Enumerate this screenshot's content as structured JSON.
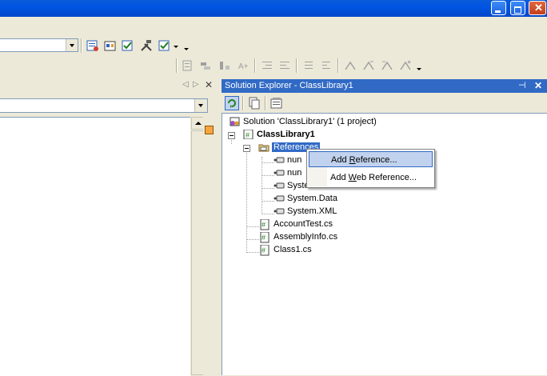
{
  "window": {
    "buttons": [
      "minimize",
      "maximize",
      "close"
    ]
  },
  "toolbar": {
    "icons_row1": [
      "properties-icon",
      "object-browser-icon",
      "toolbox-icon",
      "tools-icon",
      "command-window-icon"
    ],
    "icons_row2": [
      "align-icon",
      "size-icon",
      "spacing-icon",
      "text-size-icon",
      "indent-icon",
      "outdent-icon",
      "comment-icon",
      "uncomment-icon",
      "bookmark-icon"
    ]
  },
  "solution_explorer": {
    "title": "Solution Explorer - ClassLibrary1",
    "pin": "⊣",
    "close": "✕",
    "tree": {
      "solution": "Solution 'ClassLibrary1' (1 project)",
      "project": "ClassLibrary1",
      "references": "References",
      "ref_items": [
        "nun",
        "nun",
        "System",
        "System.Data",
        "System.XML"
      ],
      "files": [
        "AccountTest.cs",
        "AssemblyInfo.cs",
        "Class1.cs"
      ]
    }
  },
  "context_menu": {
    "items": [
      {
        "label_pre": "Add ",
        "label_ul": "R",
        "label_post": "eference...",
        "highlighted": true
      },
      {
        "label_pre": "Add ",
        "label_ul": "W",
        "label_post": "eb Reference...",
        "highlighted": false
      }
    ]
  },
  "colors": {
    "accent": "#316ac5",
    "titlebar": "#0054e3",
    "menu_highlight": "#c1d2ee"
  }
}
